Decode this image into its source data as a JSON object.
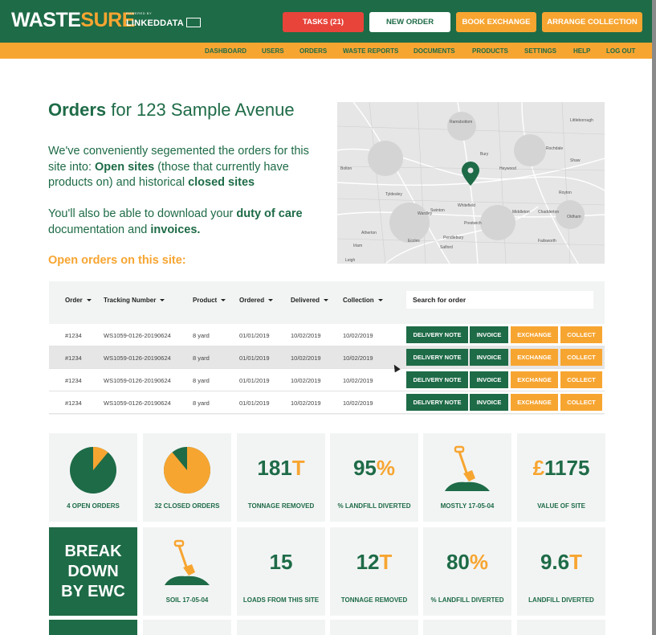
{
  "brand": {
    "logo_main": "WASTE",
    "logo_accent": "SURE",
    "powered_small": "POWERED BY",
    "powered_big": "LINKEDDATA"
  },
  "top_buttons": {
    "tasks": "TASKS (21)",
    "new_order": "NEW ORDER",
    "book_exchange": "BOOK EXCHANGE",
    "arrange_collection": "ARRANGE COLLECTION"
  },
  "nav": [
    "DASHBOARD",
    "USERS",
    "ORDERS",
    "WASTE REPORTS",
    "DOCUMENTS",
    "PRODUCTS",
    "SETTINGS",
    "HELP",
    "LOG OUT"
  ],
  "hero": {
    "title_bold": "Orders",
    "title_rest": " for 123 Sample Avenue",
    "p1_a": "We've conveniently segemented the orders for this site into: ",
    "p1_b": "Open sites",
    "p1_c": " (those that currently have products on) and historical ",
    "p1_d": "closed sites",
    "p2_a": "You'll also be able to download your ",
    "p2_b": "duty of care",
    "p2_c": " documentation and ",
    "p2_d": "invoices.",
    "open_heading": "Open orders on this site:"
  },
  "map_labels": [
    "Ramsbottom",
    "Bury",
    "Heywood",
    "Bolton",
    "Rochdale",
    "Middleton",
    "Chadderton",
    "Oldham",
    "Swinton",
    "Prestwich",
    "Eccles",
    "Salford",
    "Atherton",
    "Leigh",
    "Wardley",
    "Pendlebury",
    "Whitefield",
    "Littleborough",
    "Shaw",
    "Royton",
    "Failsworth",
    "Irlam",
    "Tyldesley"
  ],
  "table": {
    "headers": [
      "Order",
      "Tracking Number",
      "Product",
      "Ordered",
      "Delivered",
      "Collection"
    ],
    "search_placeholder": "Search for order",
    "rows": [
      [
        "#1234",
        "WS1059-0126-20190624",
        "8 yard",
        "01/01/2019",
        "10/02/2019",
        "10/02/2019"
      ],
      [
        "#1234",
        "WS1059-0126-20190624",
        "8 yard",
        "01/01/2019",
        "10/02/2019",
        "10/02/2019"
      ],
      [
        "#1234",
        "WS1059-0126-20190624",
        "8 yard",
        "01/01/2019",
        "10/02/2019",
        "10/02/2019"
      ],
      [
        "#1234",
        "WS1059-0126-20190624",
        "8 yard",
        "01/01/2019",
        "10/02/2019",
        "10/02/2019"
      ]
    ],
    "row_buttons": {
      "delivery_note": "DELIVERY NOTE",
      "invoice": "INVOICE",
      "exchange": "EXCHANGE",
      "collect": "COLLECT"
    }
  },
  "stats_row1": {
    "open_orders": "4 OPEN ORDERS",
    "open_orders_fraction": 0.11,
    "closed_orders": "32 CLOSED ORDERS",
    "closed_orders_fraction": 0.89,
    "tonnage_value": "181",
    "tonnage_unit": "T",
    "tonnage_label": "TONNAGE REMOVED",
    "landfill_value": "95",
    "landfill_unit": "%",
    "landfill_label": "% LANDFILL DIVERTED",
    "mostly_label": "MOSTLY 17-05-04",
    "value_currency": "£",
    "value_amount": "1175",
    "value_label": "VALUE OF SITE"
  },
  "stats_row2": {
    "ewc_line1": "BREAK",
    "ewc_line2": "DOWN",
    "ewc_line3": "BY EWC",
    "soil_label": "SOIL 17-05-04",
    "loads_value": "15",
    "loads_label": "LOADS FROM THIS SITE",
    "tonnage_value": "12",
    "tonnage_unit": "T",
    "tonnage_label": "TONNAGE REMOVED",
    "landfill_value": "80",
    "landfill_unit": "%",
    "landfill_label": "% LANDFILL DIVERTED",
    "diverted_value": "9.6",
    "diverted_unit": "T",
    "diverted_label": "LANDFILL DIVERTED"
  },
  "colors": {
    "green": "#1e6b47",
    "orange": "#f7a531",
    "red": "#e8443a",
    "panel": "#f2f4f4"
  }
}
